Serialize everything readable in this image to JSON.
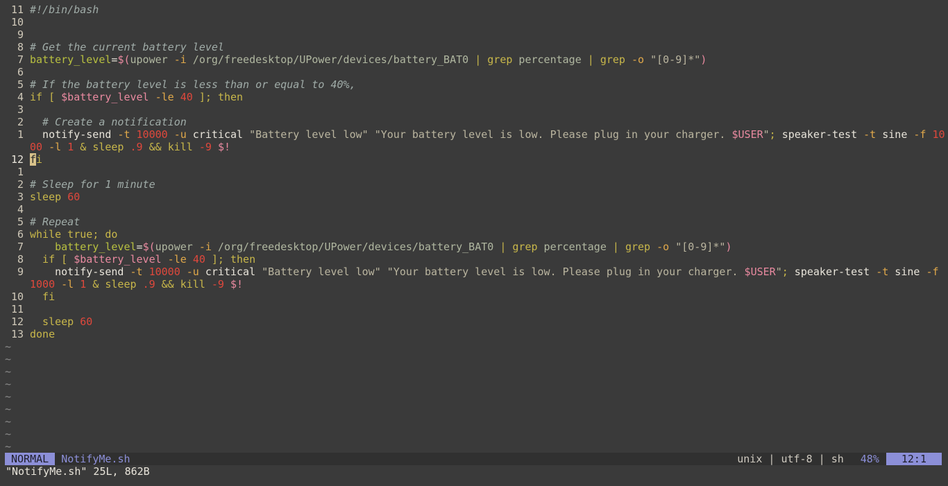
{
  "editor": {
    "lines": [
      {
        "num": "11",
        "tokens": [
          {
            "t": "#!/bin/bash",
            "c": "c"
          }
        ]
      },
      {
        "num": "10",
        "tokens": []
      },
      {
        "num": "9",
        "tokens": []
      },
      {
        "num": "8",
        "tokens": [
          {
            "t": "# Get the current battery level",
            "c": "c"
          }
        ]
      },
      {
        "num": "7",
        "tokens": [
          {
            "t": "battery_level",
            "c": "v"
          },
          {
            "t": "=",
            "c": "x"
          },
          {
            "t": "$(",
            "c": "p"
          },
          {
            "t": "upower ",
            "c": "d"
          },
          {
            "t": "-i",
            "c": "o"
          },
          {
            "t": " /org/freedesktop/UPower/devices/battery_BAT0 ",
            "c": "d"
          },
          {
            "t": "|",
            "c": "k"
          },
          {
            "t": " ",
            "c": "d"
          },
          {
            "t": "grep",
            "c": "k"
          },
          {
            "t": " percentage ",
            "c": "d"
          },
          {
            "t": "|",
            "c": "k"
          },
          {
            "t": " ",
            "c": "d"
          },
          {
            "t": "grep",
            "c": "k"
          },
          {
            "t": " ",
            "c": "d"
          },
          {
            "t": "-o",
            "c": "o"
          },
          {
            "t": " \"[0-9]*\"",
            "c": "s"
          },
          {
            "t": ")",
            "c": "p"
          }
        ]
      },
      {
        "num": "6",
        "tokens": []
      },
      {
        "num": "5",
        "tokens": [
          {
            "t": "# If the battery level is less than or equal to 40%,",
            "c": "c"
          }
        ]
      },
      {
        "num": "4",
        "tokens": [
          {
            "t": "if",
            "c": "k"
          },
          {
            "t": " [ ",
            "c": "k"
          },
          {
            "t": "$battery_level",
            "c": "p"
          },
          {
            "t": " -le ",
            "c": "o"
          },
          {
            "t": "40",
            "c": "n"
          },
          {
            "t": " ]; ",
            "c": "k"
          },
          {
            "t": "then",
            "c": "k"
          }
        ]
      },
      {
        "num": "3",
        "tokens": []
      },
      {
        "num": "2",
        "tokens": [
          {
            "t": "  # Create a notification",
            "c": "c"
          }
        ]
      },
      {
        "num": "1",
        "tokens": [
          {
            "t": "  notify-send ",
            "c": "x"
          },
          {
            "t": "-t",
            "c": "o"
          },
          {
            "t": " ",
            "c": "x"
          },
          {
            "t": "10000",
            "c": "n"
          },
          {
            "t": " ",
            "c": "x"
          },
          {
            "t": "-u",
            "c": "o"
          },
          {
            "t": " critical ",
            "c": "x"
          },
          {
            "t": "\"Battery level low\"",
            "c": "s"
          },
          {
            "t": " ",
            "c": "x"
          },
          {
            "t": "\"Your battery level is low. Please plug in your charger. ",
            "c": "s"
          },
          {
            "t": "$USER",
            "c": "p"
          },
          {
            "t": "\"",
            "c": "s"
          },
          {
            "t": "; ",
            "c": "k"
          },
          {
            "t": "speaker-test ",
            "c": "x"
          },
          {
            "t": "-t",
            "c": "o"
          },
          {
            "t": " sine ",
            "c": "x"
          },
          {
            "t": "-f",
            "c": "o"
          },
          {
            "t": " ",
            "c": "x"
          },
          {
            "t": "10",
            "c": "n"
          }
        ]
      },
      {
        "num": "",
        "tokens": [
          {
            "t": "00",
            "c": "n"
          },
          {
            "t": " ",
            "c": "x"
          },
          {
            "t": "-l",
            "c": "o"
          },
          {
            "t": " ",
            "c": "x"
          },
          {
            "t": "1",
            "c": "n"
          },
          {
            "t": " ",
            "c": "x"
          },
          {
            "t": "&",
            "c": "k"
          },
          {
            "t": " ",
            "c": "x"
          },
          {
            "t": "sleep",
            "c": "k"
          },
          {
            "t": " ",
            "c": "x"
          },
          {
            "t": ".9",
            "c": "n"
          },
          {
            "t": " ",
            "c": "x"
          },
          {
            "t": "&&",
            "c": "k"
          },
          {
            "t": " ",
            "c": "x"
          },
          {
            "t": "kill",
            "c": "k"
          },
          {
            "t": " ",
            "c": "x"
          },
          {
            "t": "-9",
            "c": "n"
          },
          {
            "t": " ",
            "c": "x"
          },
          {
            "t": "$!",
            "c": "p"
          }
        ]
      },
      {
        "num": "12",
        "cur": true,
        "tokens": [
          {
            "t": "f",
            "c": "cursor"
          },
          {
            "t": "i",
            "c": "k"
          }
        ]
      },
      {
        "num": "1",
        "tokens": []
      },
      {
        "num": "2",
        "tokens": [
          {
            "t": "# Sleep for 1 minute",
            "c": "c"
          }
        ]
      },
      {
        "num": "3",
        "tokens": [
          {
            "t": "sleep",
            "c": "k"
          },
          {
            "t": " ",
            "c": "x"
          },
          {
            "t": "60",
            "c": "n"
          }
        ]
      },
      {
        "num": "4",
        "tokens": []
      },
      {
        "num": "5",
        "tokens": [
          {
            "t": "# Repeat",
            "c": "c"
          }
        ]
      },
      {
        "num": "6",
        "tokens": [
          {
            "t": "while",
            "c": "k"
          },
          {
            "t": " true",
            "c": "k"
          },
          {
            "t": "; ",
            "c": "k"
          },
          {
            "t": "do",
            "c": "k"
          }
        ]
      },
      {
        "num": "7",
        "tokens": [
          {
            "t": "    battery_level",
            "c": "v"
          },
          {
            "t": "=",
            "c": "x"
          },
          {
            "t": "$(",
            "c": "p"
          },
          {
            "t": "upower ",
            "c": "d"
          },
          {
            "t": "-i",
            "c": "o"
          },
          {
            "t": " /org/freedesktop/UPower/devices/battery_BAT0 ",
            "c": "d"
          },
          {
            "t": "|",
            "c": "k"
          },
          {
            "t": " ",
            "c": "d"
          },
          {
            "t": "grep",
            "c": "k"
          },
          {
            "t": " percentage ",
            "c": "d"
          },
          {
            "t": "|",
            "c": "k"
          },
          {
            "t": " ",
            "c": "d"
          },
          {
            "t": "grep",
            "c": "k"
          },
          {
            "t": " ",
            "c": "d"
          },
          {
            "t": "-o",
            "c": "o"
          },
          {
            "t": " \"[0-9]*\"",
            "c": "s"
          },
          {
            "t": ")",
            "c": "p"
          }
        ]
      },
      {
        "num": "8",
        "tokens": [
          {
            "t": "  if",
            "c": "k"
          },
          {
            "t": " [ ",
            "c": "k"
          },
          {
            "t": "$battery_level",
            "c": "p"
          },
          {
            "t": " -le ",
            "c": "o"
          },
          {
            "t": "40",
            "c": "n"
          },
          {
            "t": " ]; ",
            "c": "k"
          },
          {
            "t": "then",
            "c": "k"
          }
        ]
      },
      {
        "num": "9",
        "tokens": [
          {
            "t": "    notify-send ",
            "c": "x"
          },
          {
            "t": "-t",
            "c": "o"
          },
          {
            "t": " ",
            "c": "x"
          },
          {
            "t": "10000",
            "c": "n"
          },
          {
            "t": " ",
            "c": "x"
          },
          {
            "t": "-u",
            "c": "o"
          },
          {
            "t": " critical ",
            "c": "x"
          },
          {
            "t": "\"Battery level low\"",
            "c": "s"
          },
          {
            "t": " ",
            "c": "x"
          },
          {
            "t": "\"Your battery level is low. Please plug in your charger. ",
            "c": "s"
          },
          {
            "t": "$USER",
            "c": "p"
          },
          {
            "t": "\"",
            "c": "s"
          },
          {
            "t": "; ",
            "c": "k"
          },
          {
            "t": "speaker-test ",
            "c": "x"
          },
          {
            "t": "-t",
            "c": "o"
          },
          {
            "t": " sine ",
            "c": "x"
          },
          {
            "t": "-f",
            "c": "o"
          }
        ]
      },
      {
        "num": "",
        "tokens": [
          {
            "t": "1000",
            "c": "n"
          },
          {
            "t": " ",
            "c": "x"
          },
          {
            "t": "-l",
            "c": "o"
          },
          {
            "t": " ",
            "c": "x"
          },
          {
            "t": "1",
            "c": "n"
          },
          {
            "t": " ",
            "c": "x"
          },
          {
            "t": "&",
            "c": "k"
          },
          {
            "t": " ",
            "c": "x"
          },
          {
            "t": "sleep",
            "c": "k"
          },
          {
            "t": " ",
            "c": "x"
          },
          {
            "t": ".9",
            "c": "n"
          },
          {
            "t": " ",
            "c": "x"
          },
          {
            "t": "&&",
            "c": "k"
          },
          {
            "t": " ",
            "c": "x"
          },
          {
            "t": "kill",
            "c": "k"
          },
          {
            "t": " ",
            "c": "x"
          },
          {
            "t": "-9",
            "c": "n"
          },
          {
            "t": " ",
            "c": "x"
          },
          {
            "t": "$!",
            "c": "p"
          }
        ]
      },
      {
        "num": "10",
        "tokens": [
          {
            "t": "  fi",
            "c": "k"
          }
        ]
      },
      {
        "num": "11",
        "tokens": []
      },
      {
        "num": "12",
        "tokens": [
          {
            "t": "  sleep",
            "c": "k"
          },
          {
            "t": " ",
            "c": "x"
          },
          {
            "t": "60",
            "c": "n"
          }
        ]
      },
      {
        "num": "13",
        "tokens": [
          {
            "t": "done",
            "c": "k"
          }
        ]
      }
    ],
    "tilde_rows": [
      "~",
      "~",
      "~",
      "~",
      "~",
      "~",
      "~",
      "~",
      "~"
    ]
  },
  "statusbar": {
    "mode": "NORMAL",
    "filename": "NotifyMe.sh",
    "fileinfo": "unix | utf-8 | sh",
    "percent": "48%",
    "position": "12:1"
  },
  "cmdline": "\"NotifyMe.sh\" 25L, 862B"
}
